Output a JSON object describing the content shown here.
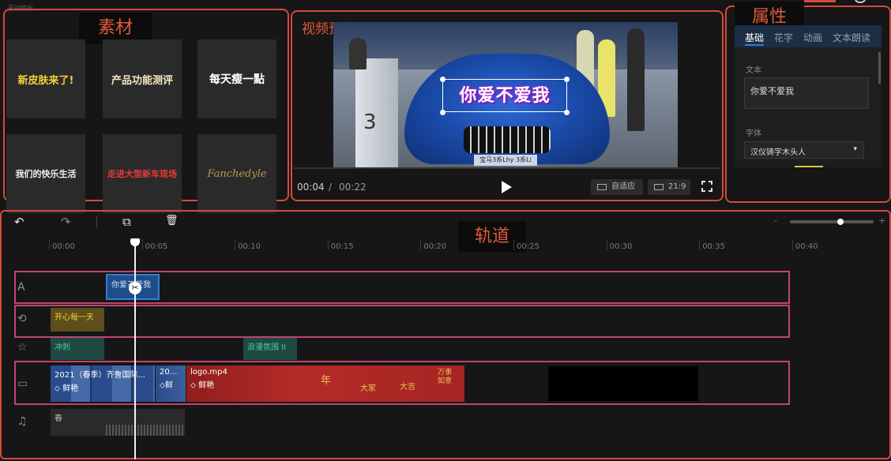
{
  "window": {
    "corner_label": "素材模板"
  },
  "sections": {
    "material": "素材",
    "preview": "视频预览",
    "properties": "属性",
    "track": "轨道"
  },
  "materials": [
    {
      "label": "新皮肤来了!",
      "color": "#f2d33a"
    },
    {
      "label": "产品功能测评",
      "color": "#f0e6c0"
    },
    {
      "label": "每天瘦一點",
      "color": "#ffffff"
    },
    {
      "label": "我们的快乐生活",
      "color": "#f0f0f0"
    },
    {
      "label": "走进大型新车现场",
      "color": "#e83a3a"
    },
    {
      "label": "Fanchedyle",
      "color": "#b59a52"
    }
  ],
  "preview": {
    "caption": "你爱不爱我",
    "plate": "宝马3系Lhy 3系Li",
    "kiosk_number": "3",
    "time_current": "00:04",
    "time_separator": "/",
    "time_total": "00:22",
    "play_icon": "play-icon",
    "fit_label": "自适应",
    "ratio_label": "21:9",
    "fullscreen_icon": "fullscreen-icon"
  },
  "properties": {
    "tabs": [
      "基础",
      "花字",
      "动画",
      "文本朗读"
    ],
    "text_label": "文本",
    "text_value": "你爱不爱我",
    "font_label": "字体",
    "font_value": "汉仪铸字木头人",
    "font_arrow": "▾"
  },
  "toolbar": {
    "undo_icon": "↶",
    "redo_icon": "↷",
    "copy_icon": "⧉",
    "delete_icon": "🗑",
    "zoom_minus": "-",
    "zoom_plus": "+",
    "zoom_level": 0.6
  },
  "timeline": {
    "ticks": [
      "00:00",
      "00:05",
      "00:10",
      "00:15",
      "00:20",
      "00:25",
      "00:30",
      "00:35",
      "00:40"
    ],
    "playhead_time": "00:04"
  },
  "tracks": {
    "text_clip": "你爱不爱我",
    "sticker_clip": "开心每一天",
    "effect_clips": [
      "冲刺",
      "浪漫氛围 II"
    ],
    "video_clips": [
      {
        "title": "2021（春季）齐鲁国际...",
        "tag": "鲜艳"
      },
      {
        "title": "20...",
        "tag": "鲜"
      },
      {
        "title": "logo.mp4",
        "tag": "鲜艳"
      }
    ],
    "video_decor": [
      "年",
      "大家",
      "大吉",
      "万事如意"
    ],
    "audio_clip": "春"
  },
  "colors": {
    "section_outline": "#d24b3c",
    "track_outline": "#c0456f",
    "accent_blue": "#2f7fd8",
    "text_clip_bg": "#1f4e87",
    "sticker_bg": "#5e4e1c",
    "effect_bg": "#1f4a41",
    "video_red": "#b42b28"
  }
}
